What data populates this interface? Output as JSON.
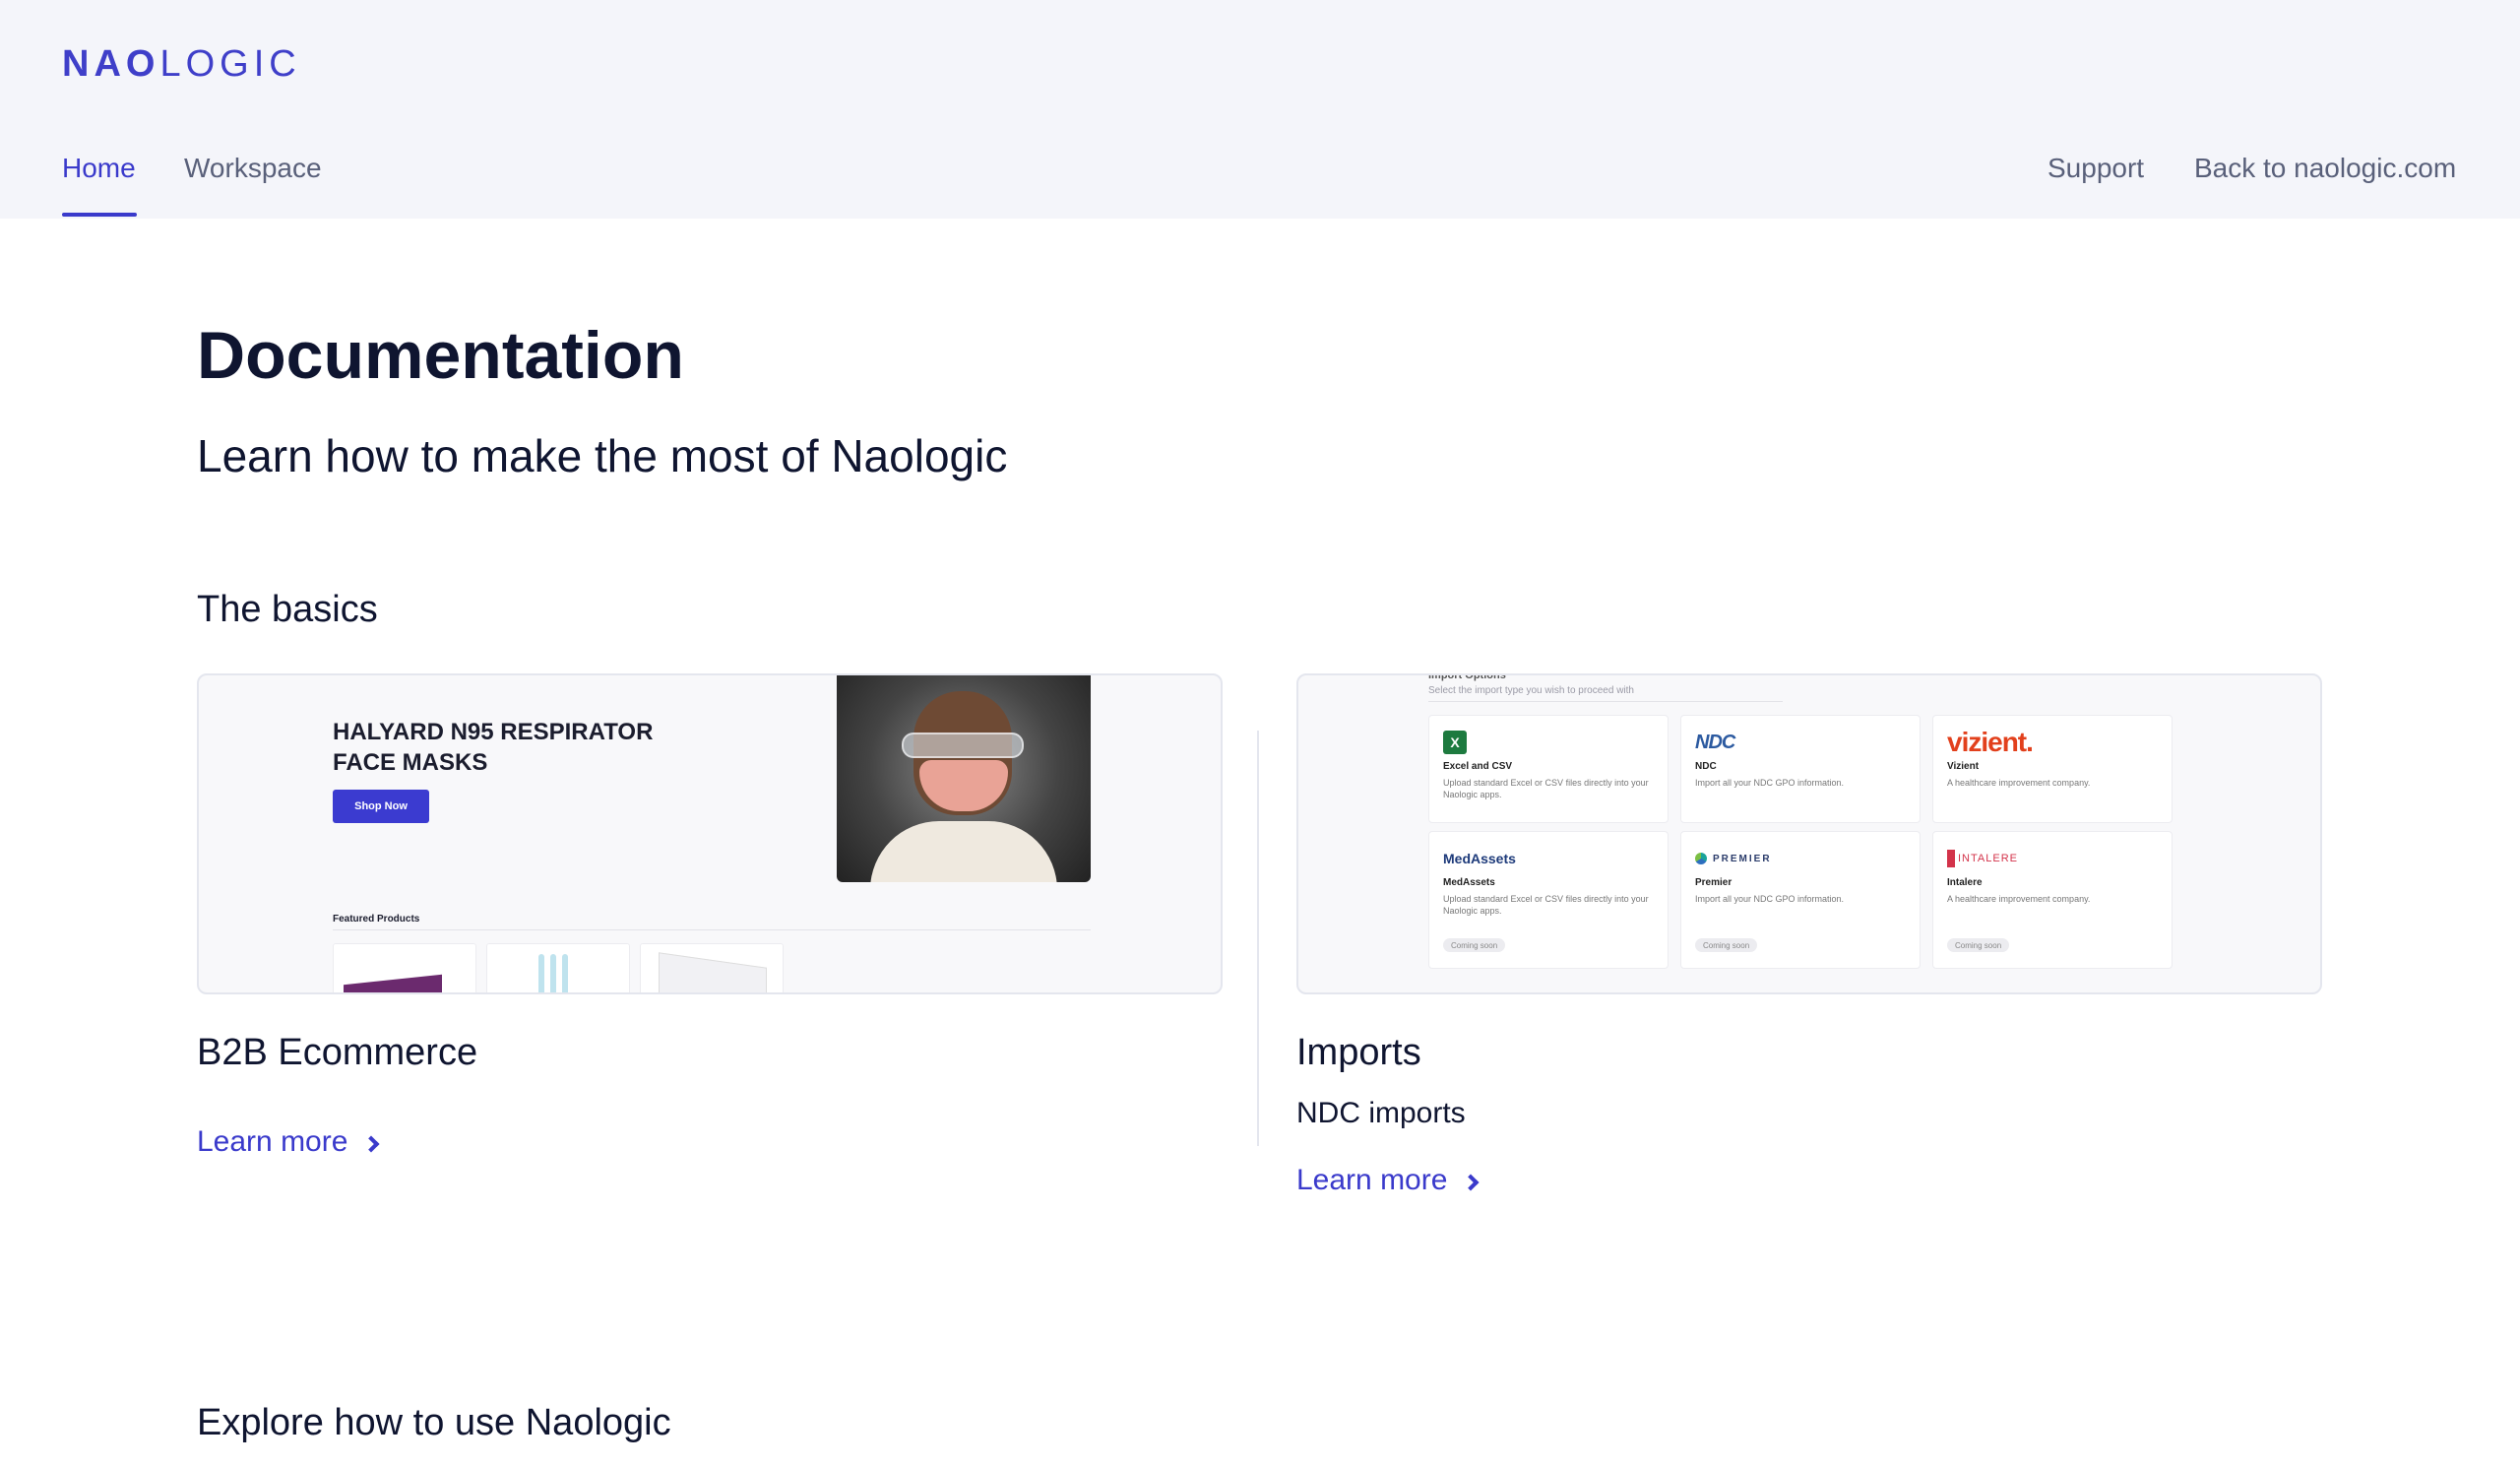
{
  "header": {
    "logo": {
      "strong": "NAO",
      "light": "LOGIC"
    },
    "nav_left": [
      {
        "label": "Home",
        "active": true
      },
      {
        "label": "Workspace",
        "active": false
      }
    ],
    "nav_right": [
      {
        "label": "Support"
      },
      {
        "label": "Back to naologic.com"
      }
    ]
  },
  "main": {
    "title": "Documentation",
    "subtitle": "Learn how to make the most of Naologic",
    "sections": [
      {
        "title": "The basics",
        "cards": [
          {
            "title": "B2B Ecommerce",
            "description": "",
            "link_label": "Learn more",
            "thumbnail": {
              "headline_line1": "HALYARD N95 RESPIRATOR",
              "headline_line2": "FACE MASKS",
              "button": "Shop Now",
              "featured_label": "Featured Products"
            }
          },
          {
            "title": "Imports",
            "description": "NDC imports",
            "link_label": "Learn more",
            "thumbnail": {
              "heading": "Import Options",
              "subheading": "Select the import type you wish to proceed with",
              "tiles": [
                {
                  "logo": "",
                  "name": "Excel and CSV",
                  "description": "Upload standard Excel or CSV files directly into your Naologic apps.",
                  "badge": ""
                },
                {
                  "logo": "NDC",
                  "name": "NDC",
                  "description": "Import all your NDC GPO information.",
                  "badge": ""
                },
                {
                  "logo": "vizient.",
                  "name": "Vizient",
                  "description": "A healthcare improvement company.",
                  "badge": ""
                },
                {
                  "logo": "MedAssets",
                  "name": "MedAssets",
                  "description": "Upload standard Excel or CSV files directly into your Naologic apps.",
                  "badge": "Coming soon"
                },
                {
                  "logo": "PREMIER",
                  "name": "Premier",
                  "description": "Import all your NDC GPO information.",
                  "badge": "Coming soon"
                },
                {
                  "logo": "INTALERE",
                  "name": "Intalere",
                  "description": "A healthcare improvement company.",
                  "badge": "Coming soon"
                }
              ]
            }
          }
        ]
      },
      {
        "title": "Explore how to use Naologic"
      }
    ]
  },
  "colors": {
    "accent": "#3a3acb",
    "header_bg": "#f4f5fa",
    "text": "#0f1530",
    "muted": "#59607a",
    "border": "#e4e6ee"
  }
}
